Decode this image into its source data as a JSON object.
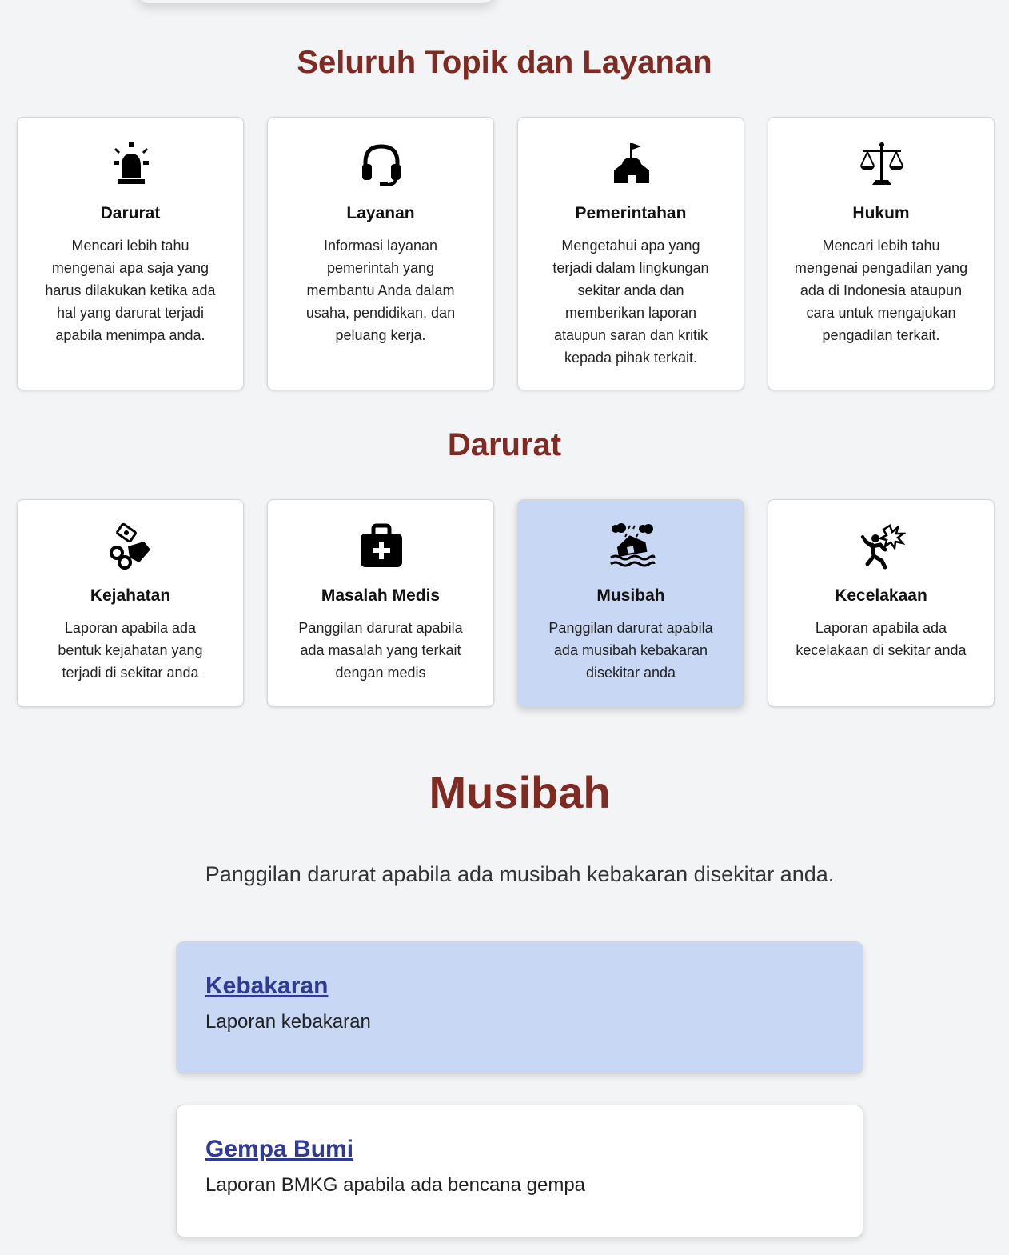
{
  "topics": {
    "title": "Seluruh Topik dan Layanan",
    "cards": [
      {
        "icon": "siren-icon",
        "title": "Darurat",
        "desc": "Mencari lebih tahu mengenai apa saja yang harus dilakukan ketika ada hal yang darurat terjadi apabila menimpa anda."
      },
      {
        "icon": "headset-icon",
        "title": "Layanan",
        "desc": "Informasi layanan pemerintah yang membantu Anda dalam usaha, pendidikan, dan peluang kerja."
      },
      {
        "icon": "government-building-icon",
        "title": "Pemerintahan",
        "desc": "Mengetahui apa yang terjadi dalam lingkungan sekitar anda dan memberikan laporan ataupun saran dan kritik kepada pihak terkait."
      },
      {
        "icon": "scales-icon",
        "title": "Hukum",
        "desc": "Mencari lebih tahu mengenai pengadilan yang ada di Indonesia ataupun cara untuk mengajukan pengadilan terkait."
      }
    ]
  },
  "darurat": {
    "title": "Darurat",
    "cards": [
      {
        "icon": "handcuffs-money-icon",
        "title": "Kejahatan",
        "desc": "Laporan apabila ada bentuk kejahatan yang terjadi di sekitar anda"
      },
      {
        "icon": "medical-kit-icon",
        "title": "Masalah Medis",
        "desc": "Panggilan darurat apabila ada masalah yang terkait dengan medis"
      },
      {
        "icon": "flood-house-icon",
        "title": "Musibah",
        "desc": "Panggilan darurat apabila ada musibah kebakaran disekitar anda"
      },
      {
        "icon": "accident-icon",
        "title": "Kecelakaan",
        "desc": "Laporan apabila ada kecelakaan di sekitar anda"
      }
    ]
  },
  "musibah": {
    "title": "Musibah",
    "intro": "Panggilan darurat apabila ada musibah kebakaran disekitar anda.",
    "reports": [
      {
        "title": "Kebakaran",
        "desc": "Laporan kebakaran"
      },
      {
        "title": "Gempa Bumi",
        "desc": "Laporan BMKG apabila ada bencana gempa"
      }
    ]
  },
  "colors": {
    "heading": "#7f2a22",
    "link": "#2e3a94",
    "active": "#c8d8f4"
  }
}
